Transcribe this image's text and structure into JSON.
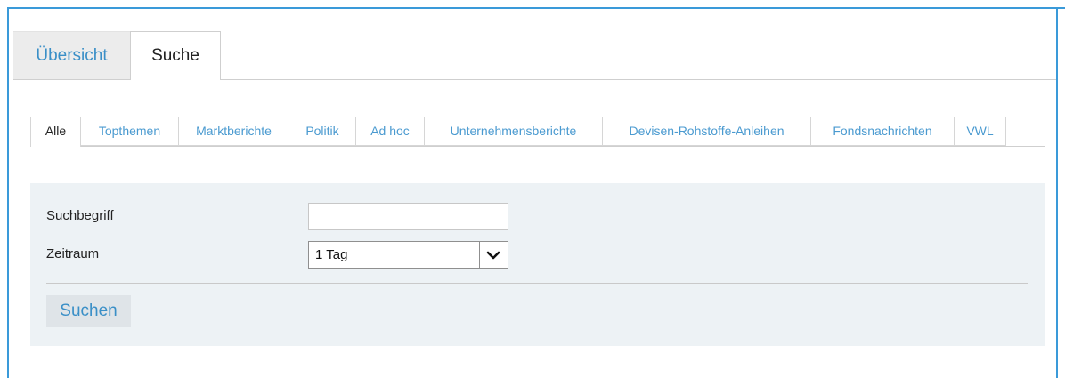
{
  "main_tabs": [
    {
      "label": "Übersicht",
      "active": false
    },
    {
      "label": "Suche",
      "active": true
    }
  ],
  "category_tabs": [
    {
      "label": "Alle",
      "active": true
    },
    {
      "label": "Topthemen",
      "active": false
    },
    {
      "label": "Marktberichte",
      "active": false
    },
    {
      "label": "Politik",
      "active": false
    },
    {
      "label": "Ad hoc",
      "active": false
    },
    {
      "label": "Unternehmensberichte",
      "active": false
    },
    {
      "label": "Devisen-Rohstoffe-Anleihen",
      "active": false
    },
    {
      "label": "Fondsnachrichten",
      "active": false
    },
    {
      "label": "VWL",
      "active": false
    }
  ],
  "search_form": {
    "query_label": "Suchbegriff",
    "query_value": "",
    "period_label": "Zeitraum",
    "period_value": "1 Tag",
    "submit_label": "Suchen"
  },
  "colors": {
    "accent": "#3a9ad9",
    "link": "#3a8fc7",
    "panel_bg": "#edf2f5"
  },
  "icons": {
    "select_arrow": "chevron-down-icon"
  }
}
